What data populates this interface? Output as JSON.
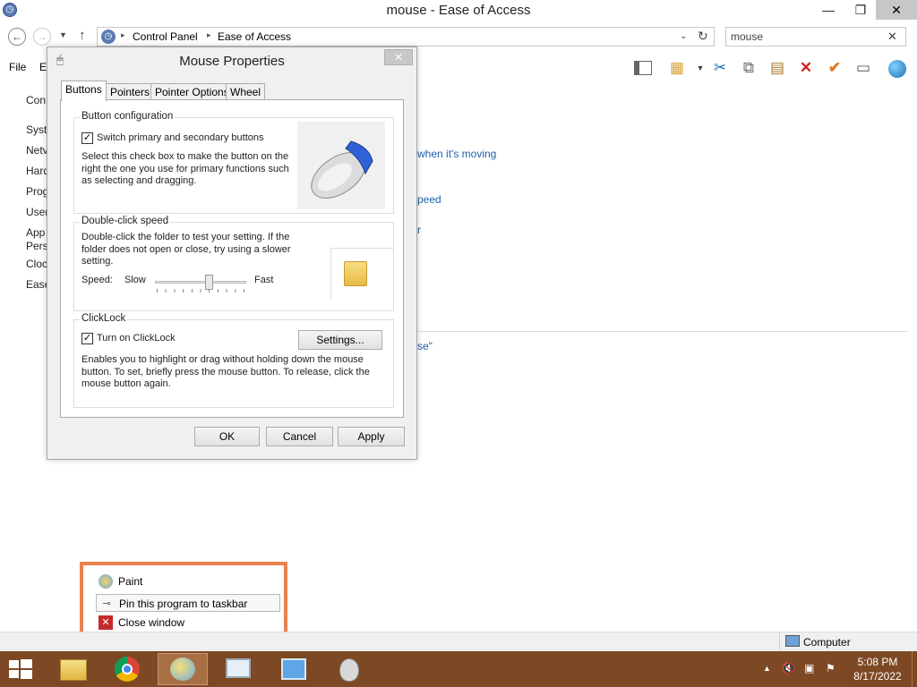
{
  "window": {
    "title": "mouse - Ease of Access",
    "minimize": "—",
    "restore": "❐",
    "close": "✕"
  },
  "address": {
    "path_root": "Control Panel",
    "path_current": "Ease of Access",
    "search_value": "mouse"
  },
  "menubar": {
    "file": "File",
    "edit": "E"
  },
  "sidenav": [
    "Con",
    "Syst",
    "Netv",
    "Hard",
    "Prog",
    "User",
    "App",
    "Pers",
    "Cloc",
    "Ease"
  ],
  "links": {
    "moving": "when it's moving",
    "speed": "peed",
    "r": "r",
    "se": "se\""
  },
  "dialog": {
    "title": "Mouse Properties",
    "tabs": [
      "Buttons",
      "Pointers",
      "Pointer Options",
      "Wheel"
    ],
    "button_config": {
      "label": "Button configuration",
      "switch_label": "Switch primary and secondary buttons",
      "switch_checked": true,
      "description": "Select this check box to make the button on the right the one you use for primary functions such as selecting and dragging."
    },
    "double_click": {
      "label": "Double-click speed",
      "description": "Double-click the folder to test your setting. If the folder does not open or close, try using a slower setting.",
      "speed_label": "Speed:",
      "slow": "Slow",
      "fast": "Fast",
      "slider_value": 0.6
    },
    "clicklock": {
      "label": "ClickLock",
      "toggle_label": "Turn on ClickLock",
      "toggle_checked": true,
      "settings_button": "Settings...",
      "description": "Enables you to highlight or drag without holding down the mouse button. To set, briefly press the mouse button. To release, click the mouse button again."
    },
    "ok": "OK",
    "cancel": "Cancel",
    "apply": "Apply"
  },
  "jumplist": {
    "app_name": "Paint",
    "pin": "Pin this program to taskbar",
    "close": "Close window"
  },
  "statusbar": {
    "computer": "Computer"
  },
  "taskbar": {
    "time": "5:08 PM",
    "date": "8/17/2022"
  },
  "colors": {
    "taskbar": "#7d4824",
    "jumplist_border": "#e9804f",
    "link": "#1e5fa8"
  }
}
